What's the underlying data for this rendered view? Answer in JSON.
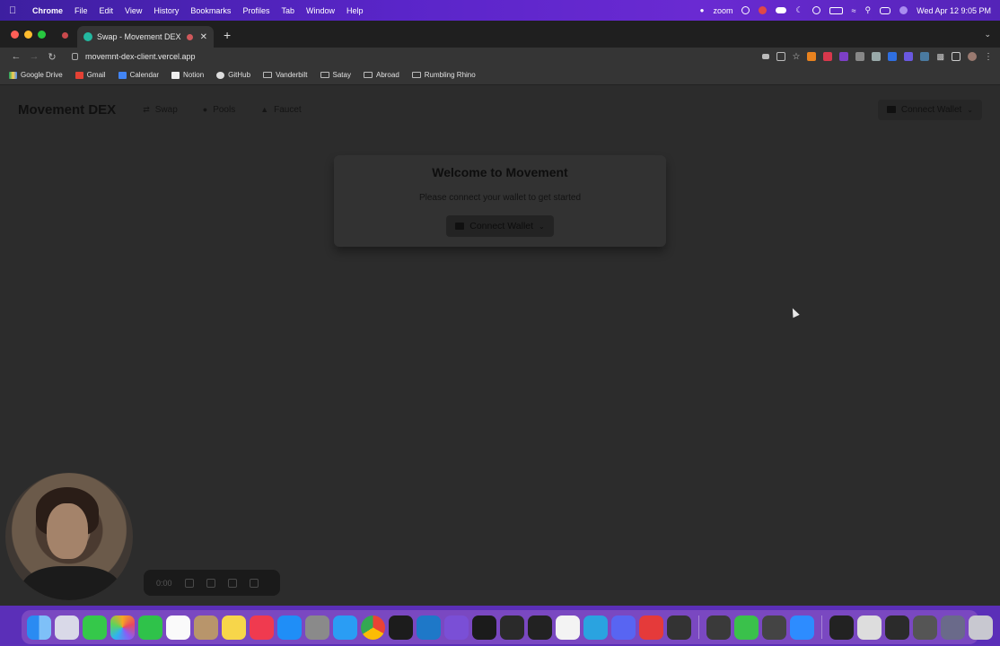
{
  "menubar": {
    "app_name": "Chrome",
    "items": [
      "File",
      "Edit",
      "View",
      "History",
      "Bookmarks",
      "Profiles",
      "Tab",
      "Window",
      "Help"
    ],
    "status": {
      "zoom": "zoom",
      "datetime": "Wed Apr 12  9:05 PM"
    }
  },
  "browser": {
    "tab_title": "Swap - Movement DEX",
    "url": "movemnt-dex-client.vercel.app",
    "bookmarks": [
      "Google Drive",
      "Gmail",
      "Calendar",
      "Notion",
      "GitHub",
      "Vanderbilt",
      "Satay",
      "Abroad",
      "Rumbling Rhino"
    ]
  },
  "site": {
    "logo": "Movement DEX",
    "nav": [
      {
        "label": "Swap",
        "icon": "swap-arrows-icon"
      },
      {
        "label": "Pools",
        "icon": "droplet-icon"
      },
      {
        "label": "Faucet",
        "icon": "faucet-icon"
      }
    ],
    "connect_wallet_label": "Connect Wallet"
  },
  "welcome": {
    "title": "Welcome to Movement",
    "subtitle": "Please connect your wallet to get started",
    "connect_wallet_label": "Connect Wallet"
  },
  "recorder": {
    "time": "0:00"
  },
  "dock": {
    "apps": [
      "finder",
      "launchpad",
      "messages",
      "photos",
      "facetime",
      "calendar",
      "contacts",
      "notes",
      "news",
      "app-store",
      "system-settings",
      "safari",
      "chrome",
      "terminal",
      "vscode",
      "visual-studio",
      "rider",
      "intellij",
      "webstorm",
      "slack",
      "telegram",
      "discord",
      "creative-cloud",
      "unity",
      "unity-hub",
      "android-file",
      "unity-alt",
      "zoom"
    ]
  }
}
